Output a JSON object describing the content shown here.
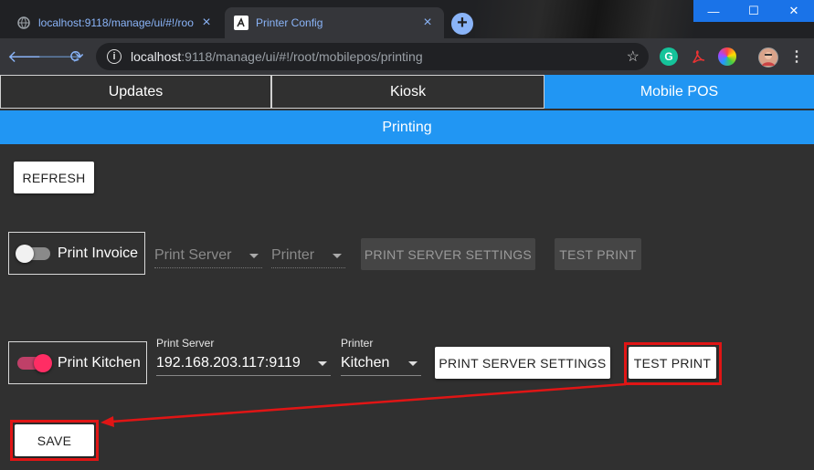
{
  "browser": {
    "tabs": [
      {
        "title": "localhost:9118/manage/ui/#!/roo",
        "active": false,
        "icon": "globe-icon"
      },
      {
        "title": "Printer Config",
        "active": true,
        "icon": "app-logo-icon"
      }
    ],
    "new_tab_label": "+",
    "window_controls": {
      "minimize": "—",
      "maximize": "☐",
      "close": "✕"
    },
    "url_host": "localhost",
    "url_rest": ":9118/manage/ui/#!/root/mobilepos/printing",
    "extension_grammarly": "G"
  },
  "app": {
    "tabs": [
      {
        "label": "Updates",
        "active": false
      },
      {
        "label": "Kiosk",
        "active": false
      },
      {
        "label": "Mobile POS",
        "active": true
      }
    ],
    "subheader": "Printing",
    "refresh_label": "REFRESH",
    "invoice": {
      "label": "Print Invoice",
      "enabled": false,
      "server_placeholder": "Print Server",
      "printer_placeholder": "Printer",
      "server_settings_label": "PRINT SERVER SETTINGS",
      "test_print_label": "TEST PRINT"
    },
    "kitchen": {
      "label": "Print Kitchen",
      "enabled": true,
      "server_label": "Print Server",
      "server_value": "192.168.203.117:9119",
      "printer_label": "Printer",
      "printer_value": "Kitchen",
      "server_settings_label": "PRINT SERVER SETTINGS",
      "test_print_label": "TEST PRINT"
    },
    "save_label": "SAVE"
  },
  "colors": {
    "accent": "#2196f3",
    "toggle_on": "#ff2d64",
    "annotation": "#e01515",
    "background": "#303030"
  }
}
